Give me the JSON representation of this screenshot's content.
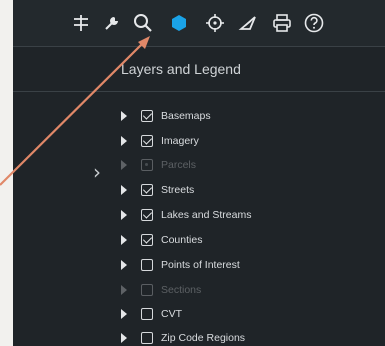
{
  "toolbar": {
    "tools": [
      {
        "icon": "layers-filter-icon"
      },
      {
        "icon": "wrench-icon"
      },
      {
        "icon": "search-icon"
      },
      {
        "icon": "basemap-hexagon-icon"
      },
      {
        "icon": "locate-icon"
      },
      {
        "icon": "measure-icon"
      },
      {
        "icon": "print-icon"
      },
      {
        "icon": "help-icon"
      }
    ]
  },
  "panel": {
    "title": "Layers and Legend"
  },
  "layers": [
    {
      "label": "Basemaps",
      "checked": true,
      "state": "normal"
    },
    {
      "label": "Imagery",
      "checked": true,
      "state": "normal"
    },
    {
      "label": "Parcels",
      "checked": false,
      "state": "faded"
    },
    {
      "label": "Streets",
      "checked": true,
      "state": "normal"
    },
    {
      "label": "Lakes and Streams",
      "checked": true,
      "state": "normal"
    },
    {
      "label": "Counties",
      "checked": true,
      "state": "normal"
    },
    {
      "label": "Points of Interest",
      "checked": false,
      "state": "normal"
    },
    {
      "label": "Sections",
      "checked": false,
      "state": "faded"
    },
    {
      "label": "CVT",
      "checked": false,
      "state": "normal"
    },
    {
      "label": "Zip Code Regions",
      "checked": false,
      "state": "normal"
    }
  ],
  "colors": {
    "panel_bg": "#1f2428",
    "accent_blue": "#1aa3e8",
    "annotation_arrow": "#e08868"
  }
}
